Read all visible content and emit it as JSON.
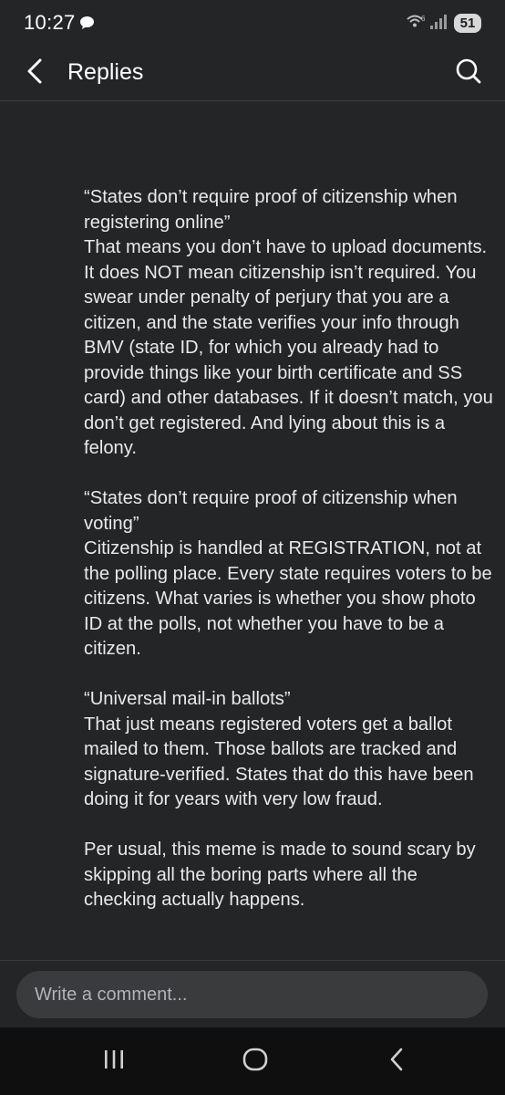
{
  "status_bar": {
    "time": "10:27",
    "battery": "51",
    "icons": [
      "chat-bubble-icon",
      "wifi-icon",
      "signal-icon"
    ]
  },
  "header": {
    "title": "Replies",
    "back_icon": "chevron-left-icon",
    "search_icon": "search-icon"
  },
  "comment": {
    "paragraphs": [
      "“States don’t require proof of citizenship when registering online”\nThat means you don’t have to upload documents. It does NOT mean citizenship isn’t required. You swear under penalty of perjury that you are a citizen, and the state verifies your info through BMV (state ID, for which you already had to provide things like your birth certificate and SS card) and other databases. If it doesn’t match, you don’t get registered. And lying about this is a felony.",
      "“States don’t require proof of citizenship when voting”\nCitizenship is handled at REGISTRATION, not at the polling place. Every state requires voters to be citizens. What varies is whether you show photo ID at the polls, not whether you have to be a citizen.",
      "“Universal mail-in ballots”\nThat just means registered voters get a ballot mailed to them. Those ballots are tracked and signature-verified. States that do this have been doing it for years with very low fraud.",
      "Per usual, this meme is made to sound scary by skipping all the boring parts where all the checking actually happens."
    ]
  },
  "comment_input": {
    "placeholder": "Write a comment..."
  },
  "nav_bar": {
    "recent_icon": "recent-apps-icon",
    "home_icon": "home-icon",
    "back_icon": "back-icon"
  },
  "colors": {
    "background": "#242526",
    "text": "#e4e6eb",
    "input_background": "#3a3b3c",
    "nav_background": "#0f0f10"
  }
}
